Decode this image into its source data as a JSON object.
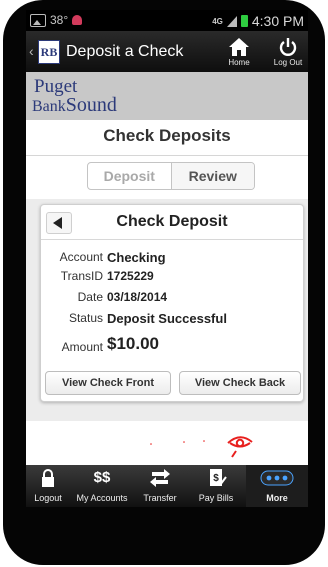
{
  "status_bar": {
    "temperature": "38°",
    "network": "4G",
    "time": "4:30 PM"
  },
  "app_bar": {
    "logo_text": "RB",
    "title": "Deposit a Check",
    "home_label": "Home",
    "logout_label": "Log Out"
  },
  "brand": {
    "line1": "Puget",
    "line2_prefix": "Bank",
    "line2_suffix": "Sound"
  },
  "page": {
    "title": "Check Deposits",
    "segments": [
      "Deposit",
      "Review"
    ],
    "active_segment": "Review"
  },
  "card": {
    "title": "Check Deposit",
    "fields": [
      {
        "label": "Account",
        "value": "Checking"
      },
      {
        "label": "TransID",
        "value": "1725229"
      },
      {
        "label": "Date",
        "value": "03/18/2014"
      },
      {
        "label": "Status",
        "value": "Deposit Successful"
      },
      {
        "label": "Amount",
        "value": "$10.00"
      }
    ],
    "buttons": {
      "front": "View Check Front",
      "back": "View Check Back"
    }
  },
  "tabbar": {
    "items": [
      {
        "label": "Logout",
        "icon": "lock-icon"
      },
      {
        "label": "My Accounts",
        "icon": "dollar-icon"
      },
      {
        "label": "Transfer",
        "icon": "transfer-arrows-icon"
      },
      {
        "label": "Pay Bills",
        "icon": "pay-bills-icon"
      },
      {
        "label": "More",
        "icon": "more-dots-icon"
      }
    ],
    "active": "More"
  },
  "colors": {
    "brand_navy": "#2c3a7a",
    "more_dots": "#4aa3ff",
    "battery": "#2ecc40",
    "eye_mark": "#e8201e"
  }
}
